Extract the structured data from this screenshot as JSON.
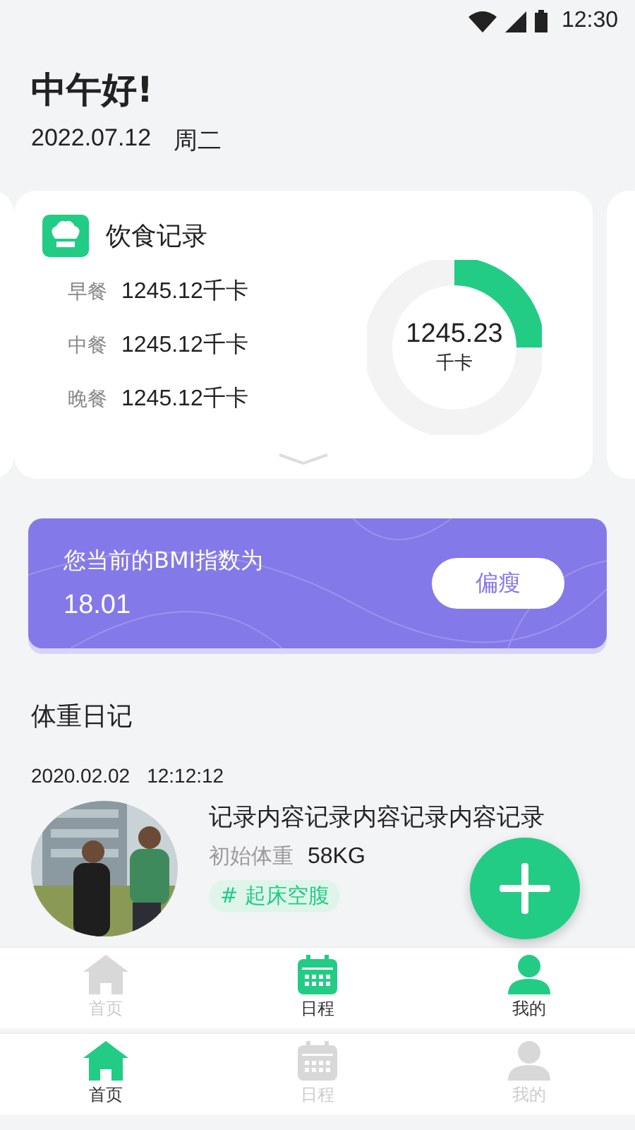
{
  "status_bar": {
    "time": "12:30"
  },
  "greeting": "中午好!",
  "date": "2022.07.12",
  "weekday": "周二",
  "diet_card": {
    "title": "饮食记录",
    "meals": [
      {
        "label": "早餐",
        "value": "1245.12千卡"
      },
      {
        "label": "中餐",
        "value": "1245.12千卡"
      },
      {
        "label": "晚餐",
        "value": "1245.12千卡"
      }
    ],
    "total": "1245.23",
    "unit": "千卡"
  },
  "bmi_card": {
    "label": "您当前的BMI指数为",
    "value": "18.01",
    "status": "偏瘦"
  },
  "weight_diary": {
    "title": "体重日记",
    "entries": [
      {
        "date": "2020.02.02",
        "time": "12:12:12",
        "kind": "picture",
        "content": "记录内容记录内容记录内容记录",
        "weight_label": "初始体重",
        "weight": "58KG",
        "tag": "# 起床空腹"
      }
    ]
  },
  "tab_bars": [
    {
      "items": [
        {
          "label": "首页",
          "kind": "home",
          "selected": false
        },
        {
          "label": "日程",
          "kind": "calendar",
          "selected": true
        },
        {
          "label": "我的",
          "kind": "person",
          "selected": true
        }
      ]
    },
    {
      "items": [
        {
          "label": "首页",
          "kind": "home",
          "selected": true
        },
        {
          "label": "日程",
          "kind": "calendar",
          "selected": false
        },
        {
          "label": "我的",
          "kind": "person",
          "selected": false
        }
      ]
    }
  ]
}
